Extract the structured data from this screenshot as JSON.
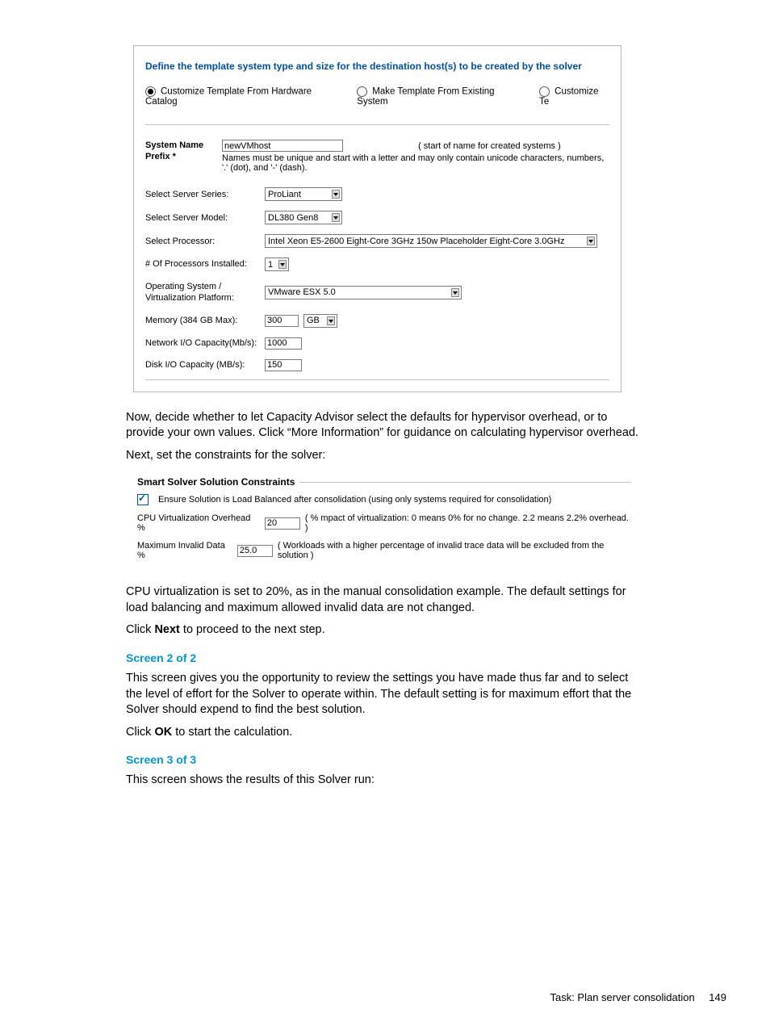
{
  "screenshot1": {
    "title": "Define the template system type and size for the destination host(s) to be created by the solver",
    "radios": {
      "r1": "Customize Template From Hardware Catalog",
      "r2": "Make Template From Existing System",
      "r3": "Customize Te"
    },
    "sysname": {
      "label": "System Name Prefix *",
      "value": "newVMhost",
      "hint_right": "( start of name for created systems )",
      "help": "Names must be unique and start with a letter and may only contain unicode characters, numbers, '.' (dot), and '-' (dash)."
    },
    "fields": {
      "series_label": "Select Server Series:",
      "series_value": "ProLiant",
      "model_label": "Select Server Model:",
      "model_value": "DL380 Gen8",
      "proc_label": "Select Processor:",
      "proc_value": "Intel Xeon E5-2600 Eight-Core 3GHz 150w Placeholder Eight-Core 3.0GHz",
      "nproc_label": "# Of Processors Installed:",
      "nproc_value": "1",
      "os_label": "Operating System / Virtualization Platform:",
      "os_value": "VMware ESX 5.0",
      "mem_label": "Memory (384 GB Max):",
      "mem_value": "300",
      "mem_unit": "GB",
      "net_label": "Network I/O Capacity(Mb/s):",
      "net_value": "1000",
      "disk_label": "Disk I/O Capacity (MB/s):",
      "disk_value": "150"
    }
  },
  "para1": "Now, decide whether to let Capacity Advisor select the defaults for hypervisor overhead, or to provide your own values. Click “More Information” for guidance on calculating hypervisor overhead.",
  "para2": "Next, set the constraints for the solver:",
  "screenshot2": {
    "title": "Smart Solver Solution Constraints",
    "cb_label": "Ensure Solution is Load Balanced after consolidation (using only systems required for consolidation)",
    "cpu_label": "CPU Virtualization Overhead %",
    "cpu_value": "20",
    "cpu_hint": "( % mpact of virtualization: 0 means 0% for no change. 2.2 means 2.2% overhead. )",
    "max_label": "Maximum Invalid Data %",
    "max_value": "25.0",
    "max_hint": "( Workloads with a higher percentage of invalid trace data will be excluded from the solution )"
  },
  "para3": "CPU virtualization is set to 20%, as in the manual consolidation example. The default settings for load balancing and maximum allowed invalid data are not changed.",
  "para4a": "Click ",
  "para4b": "Next",
  "para4c": " to proceed to the next step.",
  "h1": "Screen 2 of 2",
  "para5": "This screen gives you the opportunity to review the settings you have made thus far and to select the level of effort for the Solver to operate within. The default setting is for maximum effort that the Solver should expend to find the best solution.",
  "para6a": "Click ",
  "para6b": "OK",
  "para6c": " to start the calculation.",
  "h2": "Screen 3 of 3",
  "para7": "This screen shows the results of this Solver run:",
  "footer_label": "Task: Plan server consolidation",
  "footer_page": "149"
}
